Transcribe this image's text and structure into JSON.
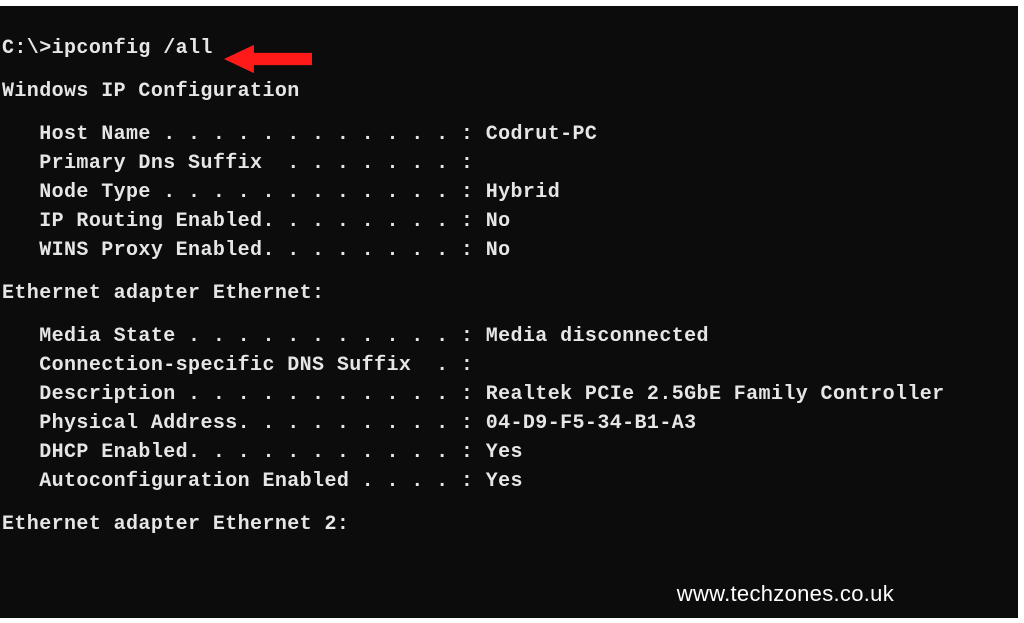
{
  "prompt": "C:\\>ipconfig /all",
  "section_ipconfig_header": "Windows IP Configuration",
  "ipconfig": [
    {
      "label": "Host Name . . . . . . . . . . . . : ",
      "value": "Codrut-PC"
    },
    {
      "label": "Primary Dns Suffix  . . . . . . . :",
      "value": ""
    },
    {
      "label": "Node Type . . . . . . . . . . . . : ",
      "value": "Hybrid"
    },
    {
      "label": "IP Routing Enabled. . . . . . . . : ",
      "value": "No"
    },
    {
      "label": "WINS Proxy Enabled. . . . . . . . : ",
      "value": "No"
    }
  ],
  "section_ethernet_header": "Ethernet adapter Ethernet:",
  "ethernet": [
    {
      "label": "Media State . . . . . . . . . . . : ",
      "value": "Media disconnected"
    },
    {
      "label": "Connection-specific DNS Suffix  . :",
      "value": ""
    },
    {
      "label": "Description . . . . . . . . . . . : ",
      "value": "Realtek PCIe 2.5GbE Family Controller"
    },
    {
      "label": "Physical Address. . . . . . . . . : ",
      "value": "04-D9-F5-34-B1-A3"
    },
    {
      "label": "DHCP Enabled. . . . . . . . . . . : ",
      "value": "Yes"
    },
    {
      "label": "Autoconfiguration Enabled . . . . : ",
      "value": "Yes"
    }
  ],
  "section_ethernet2_header": "Ethernet adapter Ethernet 2:",
  "watermark": "www.techzones.co.uk",
  "indent": "   ",
  "arrow_color": "#ff1a1a"
}
